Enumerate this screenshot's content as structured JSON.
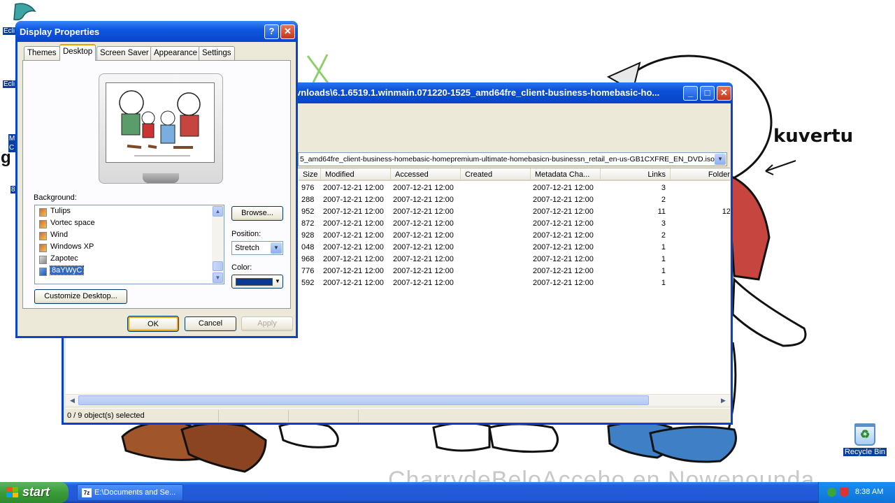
{
  "wallpaper": {
    "caption": "kuvertu",
    "signature": "CharrydeBeloAcceho en Nowenounda",
    "left_labels": [
      "Ecli",
      "Ecli",
      "M C",
      "g",
      "8"
    ]
  },
  "desktop": {
    "recycle_bin_label": "Recycle Bin"
  },
  "zip_window": {
    "title": "vnloads\\6.1.6519.1.winmain.071220-1525_amd64fre_client-business-homebasic-ho...",
    "path": "5_amd64fre_client-business-homebasic-homepremium-ultimate-homebasicn-businessn_retail_en-us-GB1CXFRE_EN_DVD.iso\\",
    "columns": [
      "Size",
      "Modified",
      "Accessed",
      "Created",
      "Metadata Cha...",
      "Links",
      "Folder"
    ],
    "rows": [
      {
        "size": "976",
        "modified": "2007-12-21 12:00",
        "accessed": "2007-12-21 12:00",
        "created": "",
        "metadata": "2007-12-21 12:00",
        "links": "3",
        "folder": ""
      },
      {
        "size": "288",
        "modified": "2007-12-21 12:00",
        "accessed": "2007-12-21 12:00",
        "created": "",
        "metadata": "2007-12-21 12:00",
        "links": "2",
        "folder": ""
      },
      {
        "size": "952",
        "modified": "2007-12-21 12:00",
        "accessed": "2007-12-21 12:00",
        "created": "",
        "metadata": "2007-12-21 12:00",
        "links": "11",
        "folder": "12"
      },
      {
        "size": "872",
        "modified": "2007-12-21 12:00",
        "accessed": "2007-12-21 12:00",
        "created": "",
        "metadata": "2007-12-21 12:00",
        "links": "3",
        "folder": ""
      },
      {
        "size": "928",
        "modified": "2007-12-21 12:00",
        "accessed": "2007-12-21 12:00",
        "created": "",
        "metadata": "2007-12-21 12:00",
        "links": "2",
        "folder": ""
      },
      {
        "size": "048",
        "modified": "2007-12-21 12:00",
        "accessed": "2007-12-21 12:00",
        "created": "",
        "metadata": "2007-12-21 12:00",
        "links": "1",
        "folder": ""
      },
      {
        "size": "968",
        "modified": "2007-12-21 12:00",
        "accessed": "2007-12-21 12:00",
        "created": "",
        "metadata": "2007-12-21 12:00",
        "links": "1",
        "folder": ""
      },
      {
        "size": "776",
        "modified": "2007-12-21 12:00",
        "accessed": "2007-12-21 12:00",
        "created": "",
        "metadata": "2007-12-21 12:00",
        "links": "1",
        "folder": ""
      },
      {
        "size": "592",
        "modified": "2007-12-21 12:00",
        "accessed": "2007-12-21 12:00",
        "created": "",
        "metadata": "2007-12-21 12:00",
        "links": "1",
        "folder": ""
      }
    ],
    "status": "0 / 9 object(s) selected",
    "buttons": {
      "minimize": "_",
      "maximize": "□",
      "close": "✕"
    }
  },
  "dialog": {
    "title": "Display Properties",
    "help": "?",
    "close": "✕",
    "tabs": [
      "Themes",
      "Desktop",
      "Screen Saver",
      "Appearance",
      "Settings"
    ],
    "active_tab": "Desktop",
    "background_label": "Background:",
    "backgrounds": [
      "Tulips",
      "Vortec space",
      "Wind",
      "Windows XP",
      "Zapotec",
      "8aYWyC"
    ],
    "selected_background": "8aYWyC",
    "browse_label": "Browse...",
    "position_label": "Position:",
    "position_value": "Stretch",
    "color_label": "Color:",
    "color_value": "#0a3a8f",
    "customize_label": "Customize Desktop...",
    "ok_label": "OK",
    "cancel_label": "Cancel",
    "apply_label": "Apply"
  },
  "taskbar": {
    "start_label": "start",
    "task_item": "E:\\Documents and Se...",
    "task_icon": "7z",
    "clock": "8:38 AM"
  }
}
